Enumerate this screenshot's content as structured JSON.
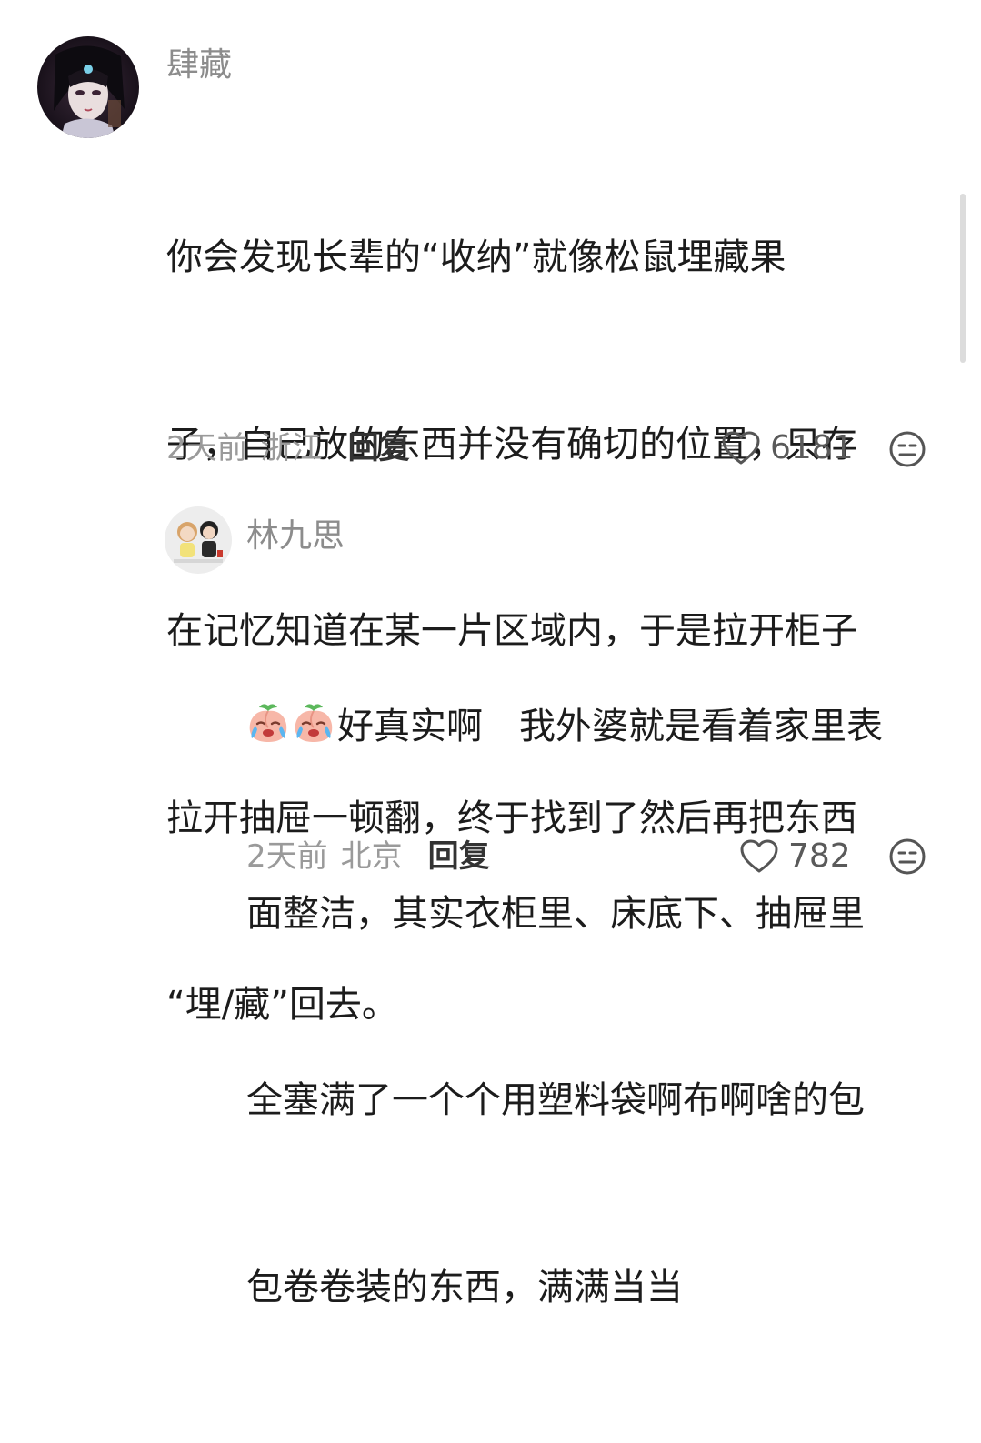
{
  "comments": [
    {
      "username": "肆藏",
      "lines": [
        "你会发现长辈的“收纳”就像松鼠埋藏果",
        "子，自己放的东西并没有确切的位置，只存",
        "在记忆知道在某一片区域内，于是拉开柜子",
        "拉开抽屉一顿翻，终于找到了然后再把东西",
        "“埋/藏”回去。"
      ],
      "time": "2天前",
      "location": "浙江",
      "reply_label": "回复",
      "likes": "6181"
    },
    {
      "username": "林九思",
      "first_line_text": "好真实啊　我外婆就是看着家里表",
      "lines": [
        "面整洁，其实衣柜里、床底下、抽屉里",
        "全塞满了一个个用塑料袋啊布啊啥的包",
        "包卷卷装的东西，满满当当"
      ],
      "time": "2天前",
      "location": "北京",
      "reply_label": "回复",
      "likes": "782",
      "emojis": [
        "crying-peach-emoji",
        "crying-peach-emoji"
      ]
    }
  ],
  "colors": {
    "text": "#1c1c1c",
    "username": "#8c8c8c",
    "meta": "#9a9a9a",
    "reply": "#333333"
  }
}
